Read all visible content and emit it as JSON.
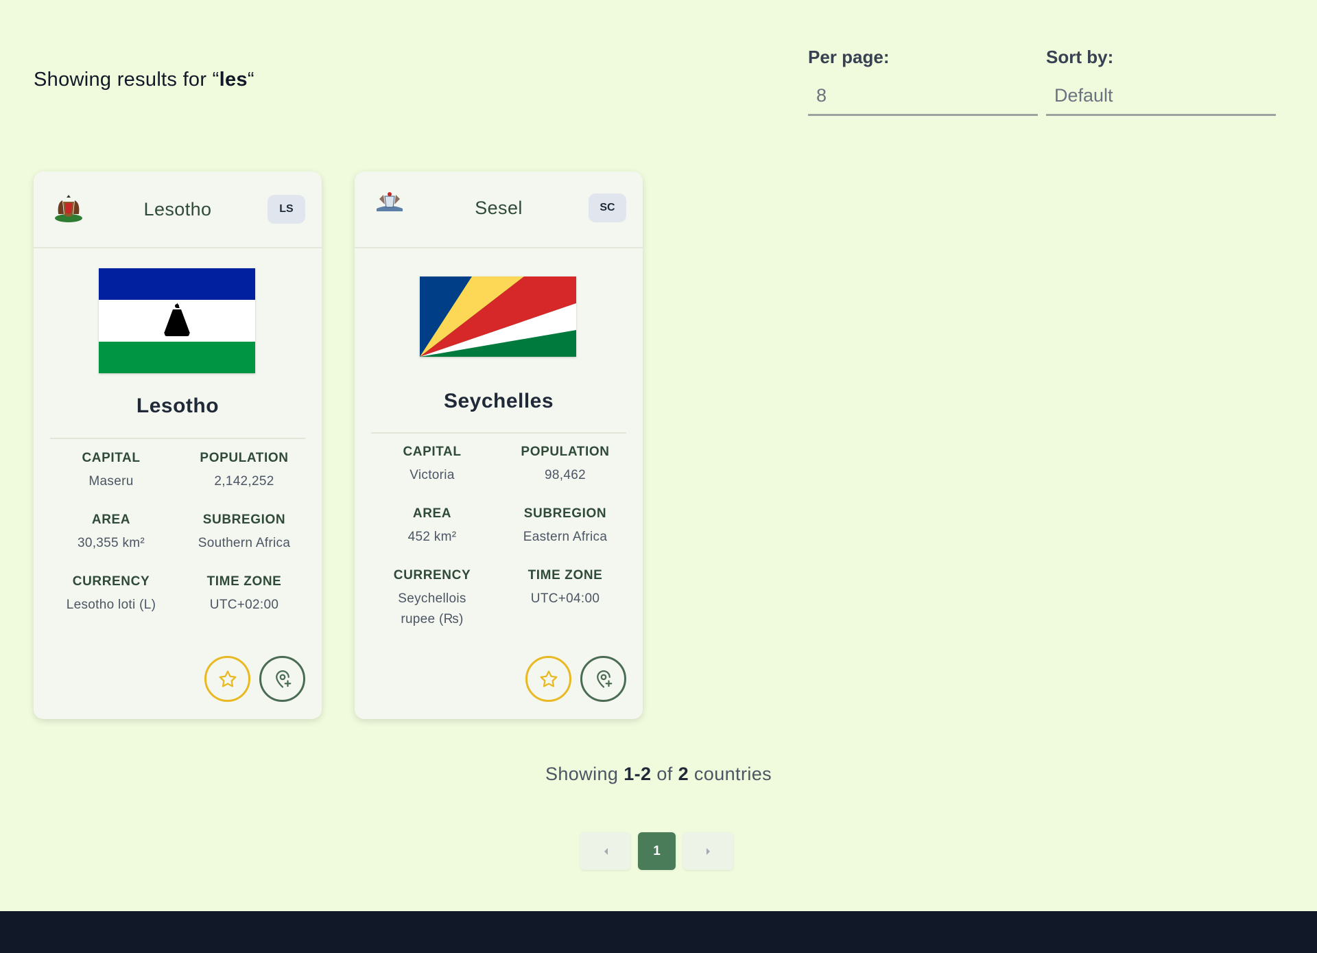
{
  "search": {
    "prefix": "Showing results for “",
    "query": "les",
    "suffix": "“"
  },
  "controls": {
    "per_page_label": "Per page:",
    "per_page_value": "8",
    "sort_label": "Sort by:",
    "sort_value": "Default"
  },
  "cards": [
    {
      "header_name": "Lesotho",
      "code": "LS",
      "title": "Lesotho",
      "facts": [
        {
          "label": "CAPITAL",
          "value": "Maseru"
        },
        {
          "label": "POPULATION",
          "value": "2,142,252"
        },
        {
          "label": "AREA",
          "value": "30,355 km²"
        },
        {
          "label": "SUBREGION",
          "value": "Southern Africa"
        },
        {
          "label": "CURRENCY",
          "value": "Lesotho loti (L)"
        },
        {
          "label": "TIME ZONE",
          "value": "UTC+02:00"
        }
      ]
    },
    {
      "header_name": "Sesel",
      "code": "SC",
      "title": "Seychelles",
      "facts": [
        {
          "label": "CAPITAL",
          "value": "Victoria"
        },
        {
          "label": "POPULATION",
          "value": "98,462"
        },
        {
          "label": "AREA",
          "value": "452 km²"
        },
        {
          "label": "SUBREGION",
          "value": "Eastern Africa"
        },
        {
          "label": "CURRENCY",
          "value": "Seychellois rupee (₨)"
        },
        {
          "label": "TIME ZONE",
          "value": "UTC+04:00"
        }
      ]
    }
  ],
  "summary": {
    "prefix": "Showing ",
    "range": "1-2",
    "mid": " of ",
    "total": "2",
    "suffix": " countries"
  },
  "pagination": {
    "prev_icon": "chevron-left-icon",
    "current": "1",
    "next_icon": "chevron-right-icon"
  },
  "icons": {
    "favorite": "star-icon",
    "map": "map-pin-plus-icon"
  },
  "colors": {
    "background": "#f0fadc",
    "accent": "#4a7c59",
    "favorite": "#e8b923",
    "footer": "#111827"
  }
}
